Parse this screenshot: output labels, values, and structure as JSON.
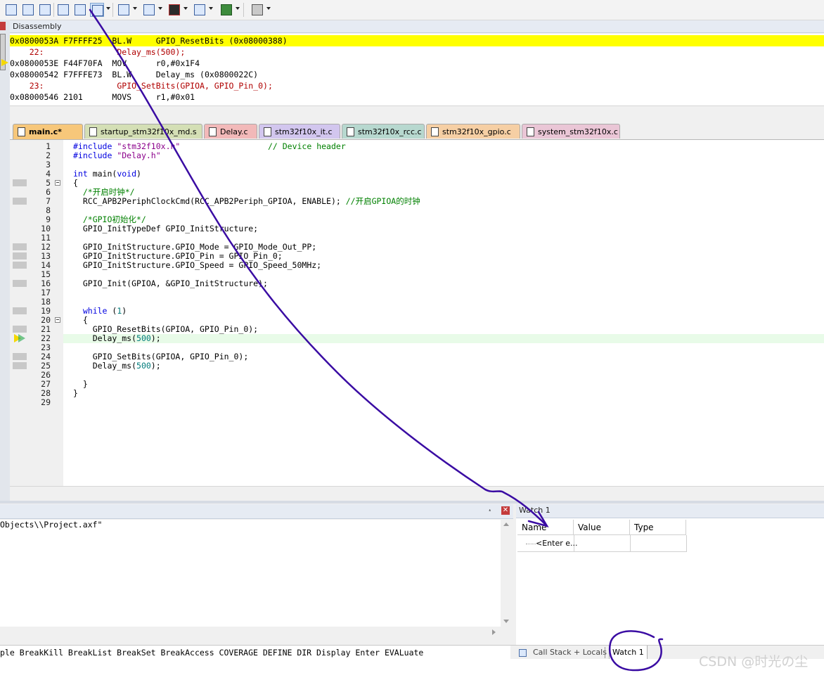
{
  "disassembly": {
    "title": "Disassembly",
    "lines": [
      {
        "text": "0x0800053A F7FFFF25  BL.W     GPIO_ResetBits (0x08000388)",
        "highlight": true
      },
      {
        "text": "    22:               Delay_ms(500);",
        "source": true
      },
      {
        "text": "0x0800053E F44F70FA  MOV      r0,#0x1F4",
        "current": true
      },
      {
        "text": "0x08000542 F7FFFE73  BL.W     Delay_ms (0x0800022C)"
      },
      {
        "text": "    23:               GPIO_SetBits(GPIOA, GPIO_Pin_0);",
        "source": true
      },
      {
        "text": "0x08000546 2101      MOVS     r1,#0x01"
      }
    ]
  },
  "tabs": [
    {
      "label": "main.c*",
      "active": true,
      "color": "#f7c77a"
    },
    {
      "label": "startup_stm32f10x_md.s",
      "color": "#d4dfb5"
    },
    {
      "label": "Delay.c",
      "color": "#f2b9b9"
    },
    {
      "label": "stm32f10x_it.c",
      "color": "#d2c6ee"
    },
    {
      "label": "stm32f10x_rcc.c",
      "color": "#b7d8cf"
    },
    {
      "label": "stm32f10x_gpio.c",
      "color": "#f6cfa4"
    },
    {
      "label": "system_stm32f10x.c",
      "color": "#eac6d6"
    }
  ],
  "editor": {
    "lines": [
      "#include \"stm32f10x.h\"                  // Device header",
      "#include \"Delay.h\"",
      "",
      "int main(void)",
      "{",
      "  /*开启时钟*/",
      "  RCC_APB2PeriphClockCmd(RCC_APB2Periph_GPIOA, ENABLE); //开启GPIOA的时钟",
      "",
      "  /*GPIO初始化*/",
      "  GPIO_InitTypeDef GPIO_InitStructure;",
      "",
      "  GPIO_InitStructure.GPIO_Mode = GPIO_Mode_Out_PP;",
      "  GPIO_InitStructure.GPIO_Pin = GPIO_Pin_0;",
      "  GPIO_InitStructure.GPIO_Speed = GPIO_Speed_50MHz;",
      "",
      "  GPIO_Init(GPIOA, &GPIO_InitStructure);",
      "",
      "",
      "  while (1)",
      "  {",
      "    GPIO_ResetBits(GPIOA, GPIO_Pin_0);",
      "    Delay_ms(500);",
      "",
      "    GPIO_SetBits(GPIOA, GPIO_Pin_0);",
      "    Delay_ms(500);",
      "",
      "  }",
      "}",
      ""
    ],
    "current_line": 22,
    "exec_lines": [
      5,
      7,
      12,
      13,
      14,
      16,
      19,
      21,
      22,
      24,
      25
    ],
    "fold_lines": [
      5,
      20
    ]
  },
  "command": {
    "output": "Objects\\\\Project.axf\"",
    "hint": "ple BreakKill BreakList BreakSet BreakAccess COVERAGE DEFINE DIR Display Enter EVALuate"
  },
  "watch": {
    "title": "Watch 1",
    "columns": [
      "Name",
      "Value",
      "Type"
    ],
    "placeholder": "<Enter e..."
  },
  "bottom_tabs": [
    "Call Stack + Locals",
    "Watch 1"
  ],
  "watermark": "CSDN @时光の尘",
  "annotation_color": "#3a0ca3"
}
